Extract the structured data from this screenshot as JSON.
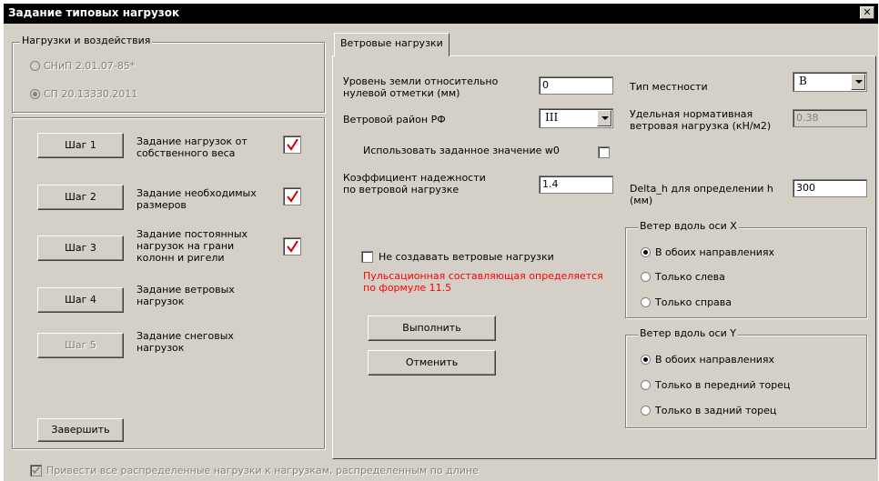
{
  "window": {
    "title": "Задание типовых нагрузок",
    "close_glyph": "✕"
  },
  "norms": {
    "legend": "Нагрузки и воздействия",
    "options": [
      {
        "label": "СНиП 2.01.07-85*",
        "selected": false
      },
      {
        "label": "СП 20.13330.2011",
        "selected": true
      }
    ]
  },
  "steps": [
    {
      "button": "Шаг 1",
      "description": [
        "Задание нагрузок от",
        "собственного веса"
      ],
      "done": true,
      "enabled": true
    },
    {
      "button": "Шаг 2",
      "description": [
        "Задание необходимых",
        "размеров"
      ],
      "done": true,
      "enabled": true
    },
    {
      "button": "Шаг 3",
      "description": [
        "Задание постоянных",
        "нагрузок на грани",
        "колонн и ригели"
      ],
      "done": true,
      "enabled": true
    },
    {
      "button": "Шаг 4",
      "description": [
        "Задание ветровых",
        "нагрузок"
      ],
      "done": false,
      "enabled": true
    },
    {
      "button": "Шаг 5",
      "description": [
        "Задание снеговых",
        "нагрузок"
      ],
      "done": false,
      "enabled": false
    }
  ],
  "finish_label": "Завершить",
  "bottom_checkbox": {
    "label": "Привести все распределенные нагрузки к нагрузкам, распределенным по длине",
    "checked": true
  },
  "tab": {
    "label": "Ветровые нагрузки",
    "ground_level": {
      "label": [
        "Уровень земли относительно",
        "нулевой отметки (мм)"
      ],
      "value": "0"
    },
    "wind_region": {
      "label": "Ветровой район РФ",
      "value": "III"
    },
    "use_w0": {
      "label": "Использовать заданное значение w0",
      "checked": false
    },
    "reliability": {
      "label": [
        "Коэффициент надежности",
        "по ветровой нагрузке"
      ],
      "value": "1.4"
    },
    "terrain": {
      "label": "Тип местности",
      "value": "B"
    },
    "norm_load": {
      "label": [
        "Удельная нормативная",
        "ветровая нагрузка (кН/м2)"
      ],
      "value": "0.38"
    },
    "delta_h": {
      "label": [
        "Delta_h для определении h",
        "(мм)"
      ],
      "value": "300"
    },
    "no_wind": {
      "label": "Не создавать ветровые нагрузки",
      "checked": false
    },
    "note": [
      "Пульсационная составляющая определяется",
      "по формуле 11.5"
    ],
    "execute_label": "Выполнить",
    "cancel_label": "Отменить",
    "wind_x": {
      "legend": "Ветер вдоль оси X",
      "options": [
        {
          "label": "В обоих направлениях",
          "selected": true
        },
        {
          "label": "Только слева",
          "selected": false
        },
        {
          "label": "Только справа",
          "selected": false
        }
      ]
    },
    "wind_y": {
      "legend": "Ветер вдоль оси Y",
      "options": [
        {
          "label": "В обоих направлениях",
          "selected": true
        },
        {
          "label": "Только в передний торец",
          "selected": false
        },
        {
          "label": "Только в задний торец",
          "selected": false
        }
      ]
    }
  },
  "colors": {
    "checkmark": "#cc0000",
    "note": "#ff0000",
    "titlebar": "#000000",
    "face": "#d4d0c8"
  }
}
